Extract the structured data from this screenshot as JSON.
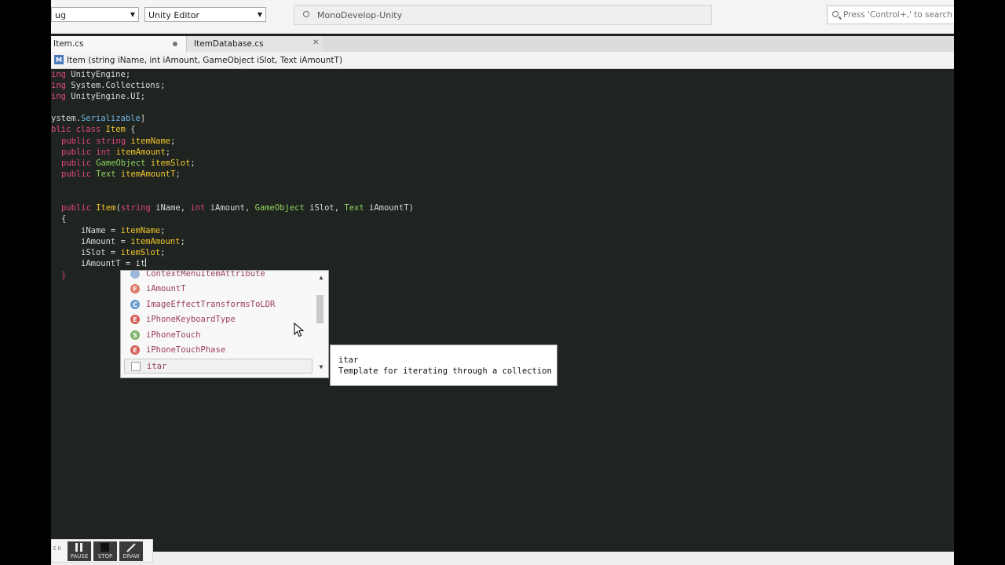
{
  "toolbar": {
    "config_combo": "ug",
    "target_combo": "Unity Editor",
    "status_text": "MonoDevelop-Unity",
    "search_placeholder": "Press 'Control+,' to search"
  },
  "tabs": [
    {
      "label": "Item.cs",
      "active": true
    },
    {
      "label": "ItemDatabase.cs",
      "active": false
    }
  ],
  "breadcrumb": {
    "icon_letter": "M",
    "text": "Item (string iName, int iAmount, GameObject iSlot, Text iAmountT)"
  },
  "code": {
    "l1": {
      "kw": "ing",
      "rest": " UnityEngine;"
    },
    "l2": {
      "kw": "ing",
      "rest": " System.Collections;"
    },
    "l3": {
      "kw": "ing",
      "rest": " UnityEngine.UI;"
    },
    "l5": {
      "a": "ystem.",
      "b": "Serializable",
      "c": "]"
    },
    "l6": {
      "kw": "blic class",
      "name": "Item",
      "rest": " {"
    },
    "l7": {
      "kw": "public",
      "ty": "string",
      "fd": "itemName",
      "end": ";"
    },
    "l8": {
      "kw": "public",
      "ty": "int",
      "fd": "itemAmount",
      "end": ";"
    },
    "l9": {
      "kw": "public",
      "ty": "GameObject",
      "fd": "itemSlot",
      "end": ";"
    },
    "l10": {
      "kw": "public",
      "ty": "Text",
      "fd": "itemAmountT",
      "end": ";"
    },
    "l13": {
      "kw": "public",
      "name": "Item",
      "open": "(",
      "t1": "string",
      "p1": " iName, ",
      "t2": "int",
      "p2": " iAmount, ",
      "t3": "GameObject",
      "p3": " iSlot, ",
      "t4": "Text",
      "p4": " iAmountT)"
    },
    "l14": "{",
    "l15": {
      "lhs": "iName = ",
      "rhs": "itemName",
      "end": ";"
    },
    "l16": {
      "lhs": "iAmount = ",
      "rhs": "itemAmount",
      "end": ";"
    },
    "l17": {
      "lhs": "iSlot = ",
      "rhs": "itemSlot",
      "end": ";"
    },
    "l18": "iAmountT = it",
    "l19": "}"
  },
  "completion": {
    "items": [
      {
        "icon": "class-icon",
        "letter": "C",
        "label": "ContextMenuItemAttribute",
        "color": "#9bb8d8"
      },
      {
        "icon": "field-icon",
        "letter": "F",
        "label": "iAmountT",
        "color": "#e07a6a"
      },
      {
        "icon": "class-icon",
        "letter": "C",
        "label": "ImageEffectTransformsToLDR",
        "color": "#6a9ad0"
      },
      {
        "icon": "enum-icon",
        "letter": "E",
        "label": "iPhoneKeyboardType",
        "color": "#d65f55"
      },
      {
        "icon": "struct-icon",
        "letter": "S",
        "label": "iPhoneTouch",
        "color": "#7bb36b"
      },
      {
        "icon": "enum-icon",
        "letter": "E",
        "label": "iPhoneTouchPhase",
        "color": "#d65f55"
      },
      {
        "icon": "template-icon",
        "letter": "",
        "label": "itar",
        "color": "#bbbbbb"
      }
    ]
  },
  "tooltip": {
    "title": "itar",
    "description": "Template for iterating through a collection"
  },
  "recorder": {
    "side": "E R",
    "pause": "PAUSE",
    "stop": "STOP",
    "draw": "DRAW"
  }
}
